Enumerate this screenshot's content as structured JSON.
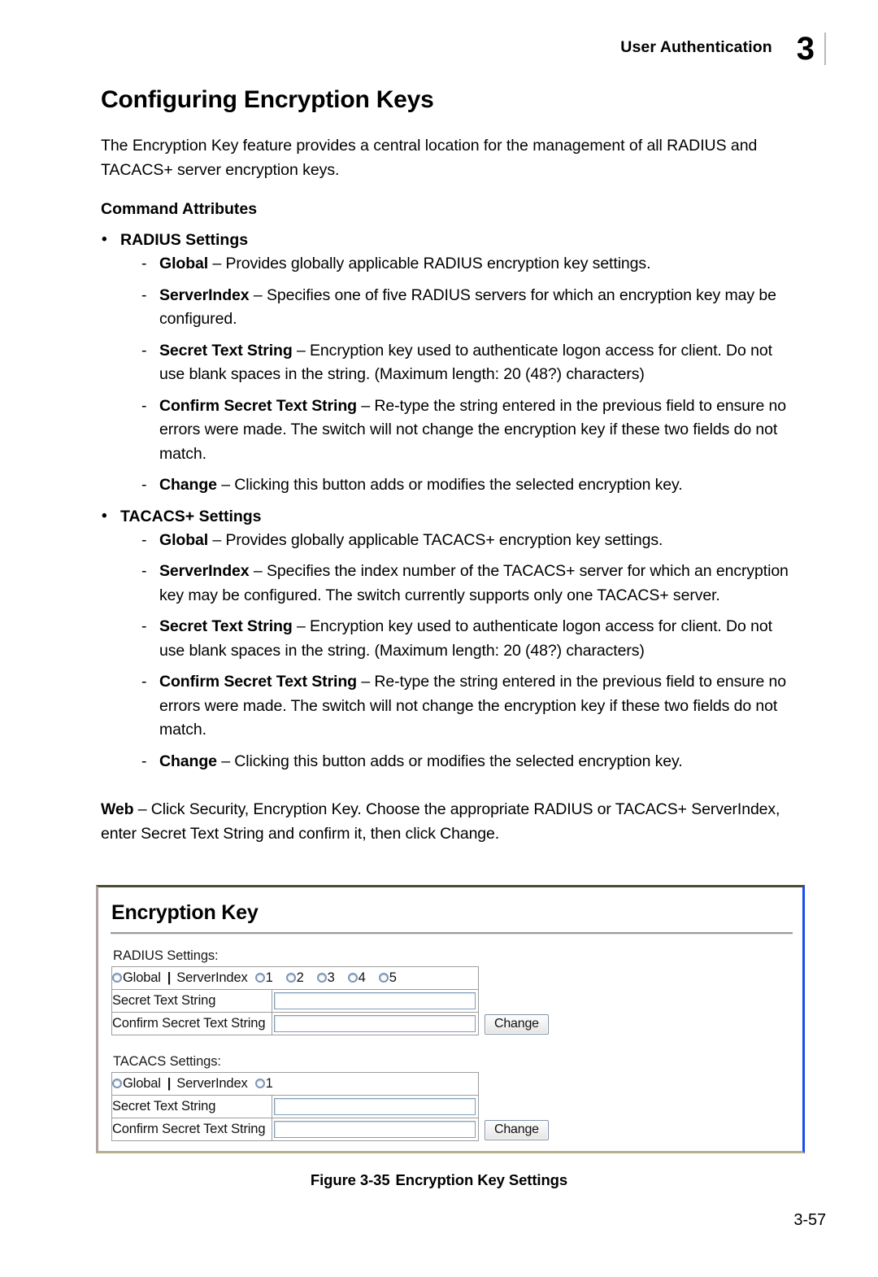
{
  "header": {
    "running_title": "User Authentication",
    "chapter_number": "3"
  },
  "document": {
    "title": "Configuring Encryption Keys",
    "intro": "The Encryption Key feature provides a central location for the management of all RADIUS and TACACS+ server encryption keys.",
    "command_attributes_heading": "Command Attributes",
    "web_label": "Web",
    "web_text": " – Click Security, Encryption Key. Choose the appropriate RADIUS or TACACS+ ServerIndex, enter Secret Text String and confirm it, then click Change.",
    "figure_caption_number": "Figure 3-35",
    "figure_caption_title": "Encryption Key Settings",
    "page_number": "3-57"
  },
  "attributes": {
    "radius": {
      "heading": "RADIUS Settings",
      "items": [
        {
          "term": "Global",
          "desc": " – Provides globally applicable RADIUS encryption key settings."
        },
        {
          "term": "ServerIndex",
          "desc": " – Specifies one of five RADIUS servers for which an encryption key may be configured."
        },
        {
          "term": "Secret Text String",
          "desc": " – Encryption key used to authenticate logon access for client. Do not use blank spaces in the string. (Maximum length: 20 (48?) characters)"
        },
        {
          "term": "Confirm Secret Text String",
          "desc": " – Re-type the string entered in the previous field to ensure no errors were made. The switch will not change the encryption key if these two fields do not match."
        },
        {
          "term": "Change",
          "desc": " – Clicking this button adds or modifies the selected encryption key."
        }
      ]
    },
    "tacacs": {
      "heading": "TACACS+ Settings",
      "items": [
        {
          "term": "Global",
          "desc": " – Provides globally applicable TACACS+ encryption key settings."
        },
        {
          "term": "ServerIndex",
          "desc": " – Specifies the index number of the TACACS+ server for which an encryption key may be configured. The switch currently supports only one TACACS+ server."
        },
        {
          "term": "Secret Text String",
          "desc": " – Encryption key used to authenticate logon access for client. Do not use blank spaces in the string. (Maximum length: 20 (48?) characters)"
        },
        {
          "term": "Confirm Secret Text String",
          "desc": " – Re-type the string entered in the previous field to ensure no errors were made. The switch will not change the encryption key if these two fields do not match."
        },
        {
          "term": "Change",
          "desc": " – Clicking this button adds or modifies the selected encryption key."
        }
      ]
    }
  },
  "screenshot": {
    "panel_title": "Encryption Key",
    "radius": {
      "section_label": "RADIUS Settings:",
      "global_label": "Global",
      "separator": "|",
      "server_index_label": "ServerIndex",
      "server_index_options": [
        "1",
        "2",
        "3",
        "4",
        "5"
      ],
      "secret_label": "Secret Text String",
      "secret_value": "",
      "confirm_label": "Confirm Secret Text String",
      "confirm_value": "",
      "change_button": "Change"
    },
    "tacacs": {
      "section_label": "TACACS Settings:",
      "global_label": "Global",
      "separator": "|",
      "server_index_label": "ServerIndex",
      "server_index_options": [
        "1"
      ],
      "secret_label": "Secret Text String",
      "secret_value": "",
      "confirm_label": "Confirm Secret Text String",
      "confirm_value": "",
      "change_button": "Change"
    },
    "colors": {
      "panel_border_top": "#4c4a33",
      "panel_border_right": "#1a4cf0",
      "panel_border_bottom": "#b8b08a",
      "input_border": "#7f9db9",
      "radio_ring": "#7b96b8"
    }
  }
}
